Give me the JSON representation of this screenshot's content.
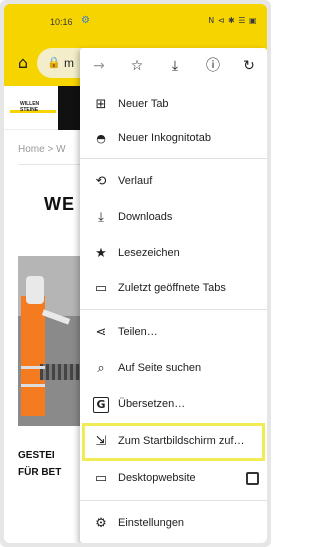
{
  "status_bar": {
    "time": "10:16",
    "gear_icon": "gear-icon",
    "indicators": "N ⊲ ✱ ☰ ▣"
  },
  "url_bar": {
    "home_icon": "home-icon",
    "lock_icon": "lock-icon",
    "url_text": "m"
  },
  "page": {
    "breadcrumb": "Home  >  W",
    "headline": "WE",
    "subheading_line1": "GESTEI",
    "subheading_line2": "FÜR BET",
    "logo_text": "WILLEN STEINE"
  },
  "menu": {
    "toolbar": [
      {
        "name": "forward-icon",
        "glyph": "→"
      },
      {
        "name": "bookmark-star-icon",
        "glyph": "☆"
      },
      {
        "name": "download-icon",
        "glyph": "⤓"
      },
      {
        "name": "info-icon",
        "glyph": "ⓘ"
      },
      {
        "name": "reload-icon",
        "glyph": "↻"
      }
    ],
    "items": [
      {
        "label": "Neuer Tab",
        "icon": "new-tab-icon",
        "glyph": "⊞"
      },
      {
        "label": "Neuer Inkognitotab",
        "icon": "incognito-icon",
        "glyph": "🕶"
      },
      {
        "label": "Verlauf",
        "icon": "history-icon",
        "glyph": "⟲"
      },
      {
        "label": "Downloads",
        "icon": "downloads-icon",
        "glyph": "⤓"
      },
      {
        "label": "Lesezeichen",
        "icon": "bookmarks-icon",
        "glyph": "★"
      },
      {
        "label": "Zuletzt geöffnete Tabs",
        "icon": "recent-tabs-icon",
        "glyph": "▭"
      },
      {
        "label": "Teilen…",
        "icon": "share-icon",
        "glyph": "⋖"
      },
      {
        "label": "Auf Seite suchen",
        "icon": "find-in-page-icon",
        "glyph": "⌕"
      },
      {
        "label": "Übersetzen…",
        "icon": "translate-icon",
        "glyph": "G"
      },
      {
        "label": "Zum Startbildschirm zuf…",
        "icon": "add-to-home-icon",
        "glyph": "⇲"
      },
      {
        "label": "Desktopwebsite",
        "icon": "desktop-icon",
        "glyph": "▭"
      },
      {
        "label": "Einstellungen",
        "icon": "settings-icon",
        "glyph": "⚙"
      }
    ]
  },
  "colors": {
    "accent_yellow": "#f5d400",
    "highlight_yellow": "#f2ec54",
    "text_dark": "#222222"
  }
}
